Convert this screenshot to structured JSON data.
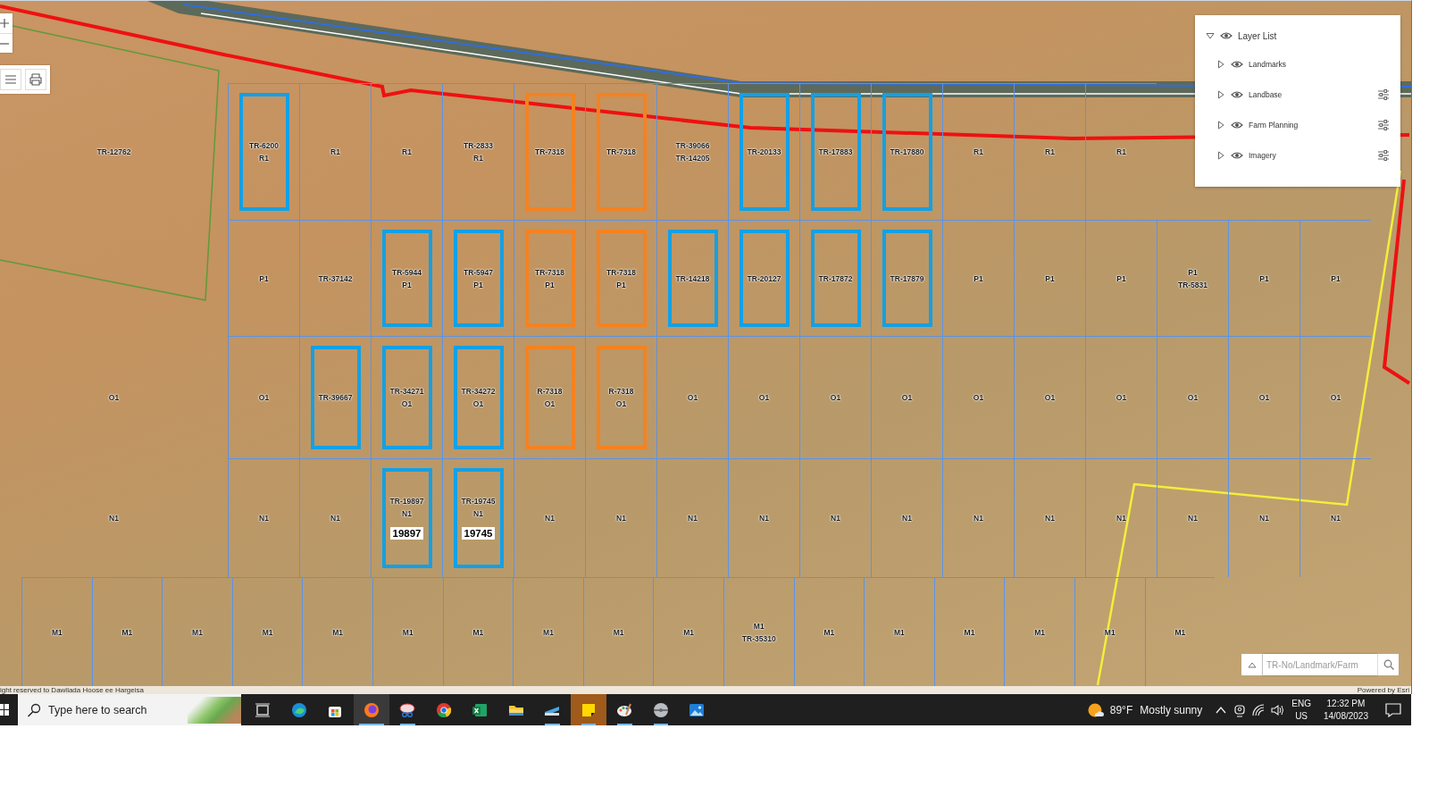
{
  "map": {
    "rows": [
      {
        "left": [
          "TR-12762"
        ],
        "parcels": [
          {
            "labels": [
              "TR-6200",
              "R1"
            ],
            "color": "#14a0e4"
          },
          {
            "labels": [
              "R1"
            ]
          },
          {
            "labels": [
              "R1"
            ]
          },
          {
            "labels": [
              "TR-2833",
              "R1"
            ]
          },
          {
            "labels": [
              "TR-7318"
            ],
            "color": "#f5821f"
          },
          {
            "labels": [
              "TR-7318"
            ],
            "color": "#f5821f"
          },
          {
            "labels": [
              "TR-39066",
              "TR-14205"
            ]
          },
          {
            "labels": [
              "TR-20133"
            ],
            "color": "#14a0e4"
          },
          {
            "labels": [
              "TR-17883"
            ],
            "color": "#14a0e4"
          },
          {
            "labels": [
              "TR-17880"
            ],
            "color": "#14a0e4"
          },
          {
            "labels": [
              "R1"
            ]
          },
          {
            "labels": [
              "R1"
            ]
          },
          {
            "labels": [
              "R1"
            ]
          }
        ]
      },
      {
        "parcels": [
          {
            "labels": [
              "P1"
            ]
          },
          {
            "labels": [
              "TR-37142"
            ]
          },
          {
            "labels": [
              "TR-5944",
              "P1"
            ],
            "color": "#14a0e4"
          },
          {
            "labels": [
              "TR-5947",
              "P1"
            ],
            "color": "#14a0e4"
          },
          {
            "labels": [
              "TR-7318",
              "P1"
            ],
            "color": "#f5821f"
          },
          {
            "labels": [
              "TR-7318",
              "P1"
            ],
            "color": "#f5821f"
          },
          {
            "labels": [
              "TR-14218"
            ],
            "color": "#14a0e4"
          },
          {
            "labels": [
              "TR-20127"
            ],
            "color": "#14a0e4"
          },
          {
            "labels": [
              "TR-17872"
            ],
            "color": "#14a0e4"
          },
          {
            "labels": [
              "TR-17879"
            ],
            "color": "#14a0e4"
          },
          {
            "labels": [
              "P1"
            ]
          },
          {
            "labels": [
              "P1"
            ]
          },
          {
            "labels": [
              "P1"
            ]
          },
          {
            "labels": [
              "P1",
              "TR-5831"
            ]
          },
          {
            "labels": [
              "P1"
            ]
          },
          {
            "labels": [
              "P1"
            ]
          }
        ]
      },
      {
        "left": [
          "O1"
        ],
        "parcels": [
          {
            "labels": [
              "O1"
            ]
          },
          {
            "labels": [
              "TR-39667"
            ],
            "color": "#14a0e4"
          },
          {
            "labels": [
              "TR-34271",
              "O1"
            ],
            "color": "#14a0e4"
          },
          {
            "labels": [
              "TR-34272",
              "O1"
            ],
            "color": "#14a0e4"
          },
          {
            "labels": [
              "R-7318",
              "O1"
            ],
            "color": "#f5821f"
          },
          {
            "labels": [
              "R-7318",
              "O1"
            ],
            "color": "#f5821f"
          },
          {
            "labels": [
              "O1"
            ]
          },
          {
            "labels": [
              "O1"
            ]
          },
          {
            "labels": [
              "O1"
            ]
          },
          {
            "labels": [
              "O1"
            ]
          },
          {
            "labels": [
              "O1"
            ]
          },
          {
            "labels": [
              "O1"
            ]
          },
          {
            "labels": [
              "O1"
            ]
          },
          {
            "labels": [
              "O1"
            ]
          },
          {
            "labels": [
              "O1"
            ]
          },
          {
            "labels": [
              "O1"
            ]
          }
        ]
      },
      {
        "left": [
          "N1"
        ],
        "parcels": [
          {
            "labels": [
              "N1"
            ]
          },
          {
            "labels": [
              "N1"
            ]
          },
          {
            "labels": [
              "TR-19897",
              "N1"
            ],
            "tag": "19897",
            "color": "#14a0e4"
          },
          {
            "labels": [
              "TR-19745",
              "N1"
            ],
            "tag": "19745",
            "color": "#14a0e4"
          },
          {
            "labels": [
              "N1"
            ]
          },
          {
            "labels": [
              "N1"
            ]
          },
          {
            "labels": [
              "N1"
            ]
          },
          {
            "labels": [
              "N1"
            ]
          },
          {
            "labels": [
              "N1"
            ]
          },
          {
            "labels": [
              "N1"
            ]
          },
          {
            "labels": [
              "N1"
            ]
          },
          {
            "labels": [
              "N1"
            ]
          },
          {
            "labels": [
              "N1"
            ]
          },
          {
            "labels": [
              "N1"
            ]
          },
          {
            "labels": [
              "N1"
            ]
          },
          {
            "labels": [
              "N1"
            ]
          }
        ]
      }
    ],
    "bottom_row": [
      {
        "labels": [
          "M1"
        ]
      },
      {
        "labels": [
          "M1"
        ]
      },
      {
        "labels": [
          "M1"
        ]
      },
      {
        "labels": [
          "M1"
        ]
      },
      {
        "labels": [
          "M1"
        ]
      },
      {
        "labels": [
          "M1"
        ]
      },
      {
        "labels": [
          "M1"
        ]
      },
      {
        "labels": [
          "M1"
        ]
      },
      {
        "labels": [
          "M1"
        ]
      },
      {
        "labels": [
          "M1"
        ]
      },
      {
        "labels": [
          "M1",
          "TR-35310"
        ]
      },
      {
        "labels": [
          "M1"
        ]
      },
      {
        "labels": [
          "M1"
        ]
      },
      {
        "labels": [
          "M1"
        ]
      },
      {
        "labels": [
          "M1"
        ]
      },
      {
        "labels": [
          "M1"
        ]
      },
      {
        "labels": [
          "M1"
        ]
      }
    ],
    "attribution": "ight reserved to Dawllada Hoose ee Hargeisa",
    "powered_by": "Powered by Esri",
    "layer_list": {
      "title": "Layer List",
      "expanded": true,
      "visible": true,
      "layers": [
        {
          "name": "Landmarks",
          "expanded": false,
          "visible": true,
          "options": false
        },
        {
          "name": "Landbase",
          "expanded": false,
          "visible": true,
          "options": true
        },
        {
          "name": "Farm Planning",
          "expanded": false,
          "visible": true,
          "options": true
        },
        {
          "name": "Imagery",
          "expanded": false,
          "visible": true,
          "options": true
        }
      ]
    },
    "search": {
      "placeholder": "TR-No/Landmark/Farm"
    }
  },
  "taskbar": {
    "search": {
      "placeholder": "Type here to search"
    },
    "apps": [
      {
        "kind": "taskview",
        "selected": false,
        "running": false,
        "flagged": false
      },
      {
        "kind": "edge",
        "selected": false,
        "running": false,
        "flagged": false
      },
      {
        "kind": "store",
        "selected": false,
        "running": false,
        "flagged": false
      },
      {
        "kind": "firefox",
        "selected": true,
        "running": true,
        "flagged": false
      },
      {
        "kind": "snip",
        "selected": false,
        "running": true,
        "flagged": false
      },
      {
        "kind": "chrome",
        "selected": false,
        "running": false,
        "flagged": false
      },
      {
        "kind": "excel",
        "selected": false,
        "running": false,
        "flagged": false
      },
      {
        "kind": "explorer",
        "selected": false,
        "running": false,
        "flagged": false
      },
      {
        "kind": "scanner",
        "selected": false,
        "running": true,
        "flagged": false
      },
      {
        "kind": "sticky",
        "selected": false,
        "running": true,
        "flagged": true
      },
      {
        "kind": "paint",
        "selected": false,
        "running": true,
        "flagged": false
      },
      {
        "kind": "disc",
        "selected": false,
        "running": true,
        "flagged": false
      },
      {
        "kind": "photos",
        "selected": false,
        "running": false,
        "flagged": false
      }
    ],
    "weather": {
      "temperature": "89°F",
      "condition": "Mostly sunny"
    },
    "language": "ENG",
    "region": "US",
    "time": "12:32 PM",
    "date": "14/08/2023"
  }
}
